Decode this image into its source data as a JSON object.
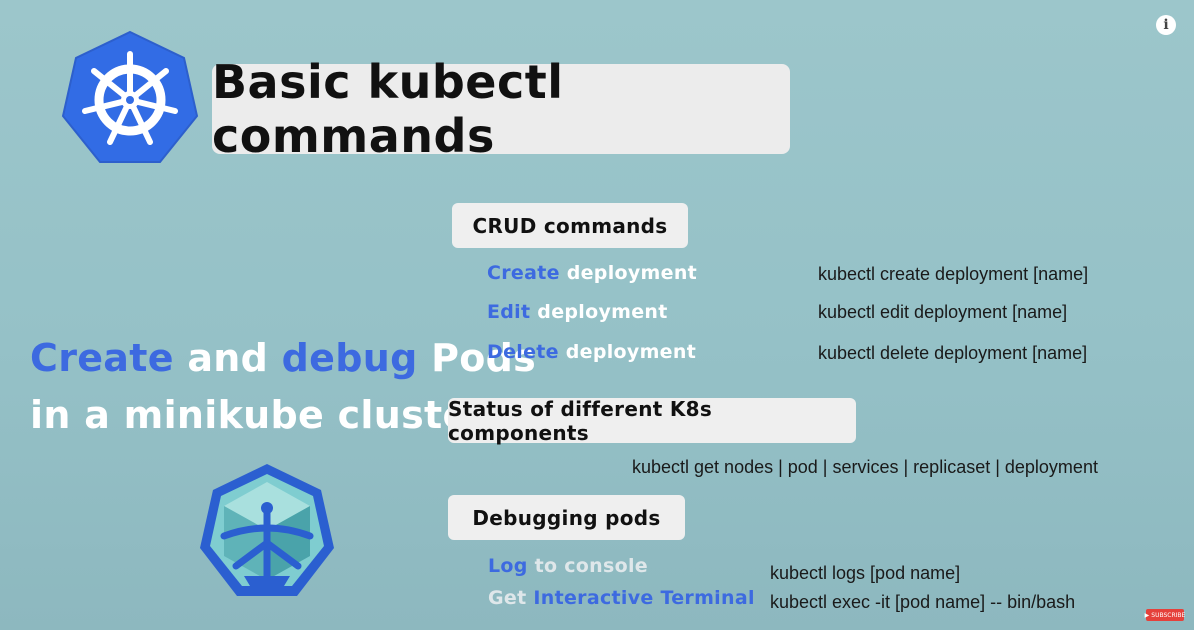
{
  "title": "Basic kubectl commands",
  "sidebar": {
    "line1": {
      "w1": "Create",
      "w2": "and",
      "w3": "debug",
      "w4": "Pods"
    },
    "line2": "in a minikube cluster"
  },
  "sections": {
    "crud": {
      "label": "CRUD commands",
      "rows": [
        {
          "verb": "Create",
          "object": "deployment",
          "command": "kubectl create deployment [name]"
        },
        {
          "verb": "Edit",
          "object": "deployment",
          "command": "kubectl edit deployment [name]"
        },
        {
          "verb": "Delete",
          "object": "deployment",
          "command": "kubectl delete deployment [name]"
        }
      ]
    },
    "status": {
      "label": "Status of different K8s components",
      "command": "kubectl get nodes | pod | services | replicaset | deployment"
    },
    "debug": {
      "label": "Debugging pods",
      "rows": [
        {
          "verb": "Log",
          "object": "to console",
          "command": "kubectl logs [pod name]"
        },
        {
          "verb": "Get",
          "object": "Interactive Terminal",
          "command": "kubectl exec -it [pod name] -- bin/bash"
        }
      ]
    }
  },
  "overlay": {
    "info_glyph": "i",
    "subscribe_label": "SUBSCRIBE"
  },
  "colors": {
    "background": "#9cc6cb",
    "accent_blue": "#3d6ae0",
    "k8s_blue": "#326ce5",
    "minikube_teal": "#5fb3b8"
  },
  "icons": [
    "kubernetes-logo-icon",
    "minikube-logo-icon",
    "info-icon",
    "youtube-play-icon"
  ]
}
